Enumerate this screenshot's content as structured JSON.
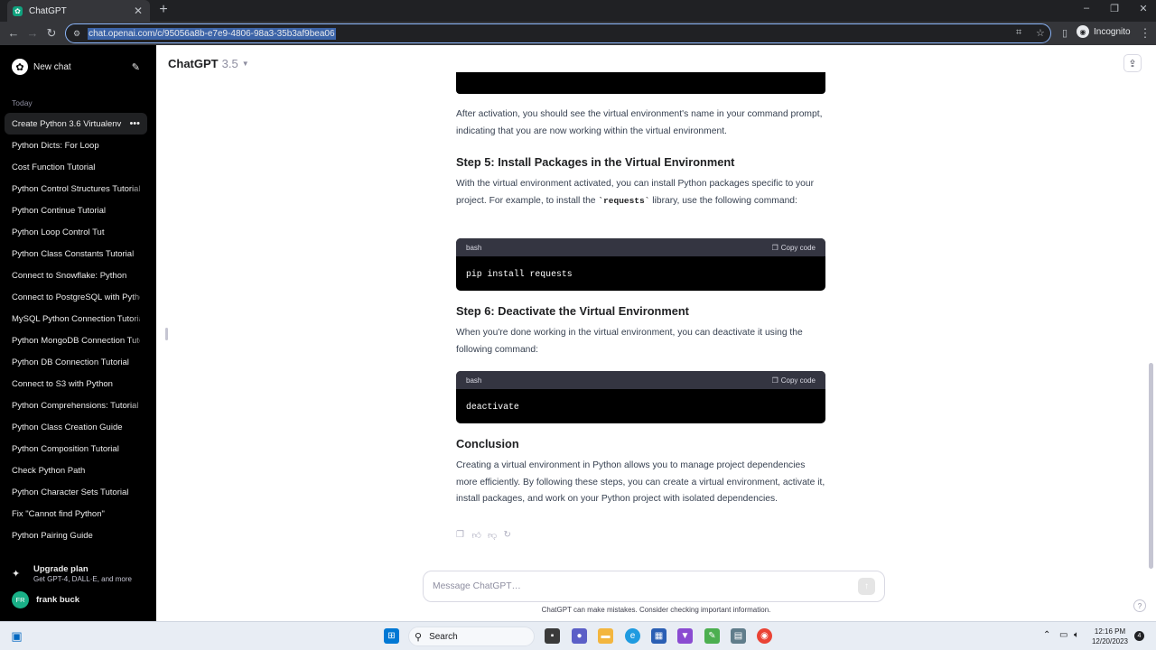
{
  "browser": {
    "tab_title": "ChatGPT",
    "tab_close": "✕",
    "new_tab": "+",
    "url": "chat.openai.com/c/95056a8b-e7e9-4806-98a3-35b3af9bea06",
    "profile_label": "Incognito"
  },
  "sidebar": {
    "new_chat_label": "New chat",
    "section_label": "Today",
    "chats": [
      {
        "title": "Create Python 3.6 Virtualenv"
      },
      {
        "title": "Python Dicts: For Loop"
      },
      {
        "title": "Cost Function Tutorial"
      },
      {
        "title": "Python Control Structures Tutorial"
      },
      {
        "title": "Python Continue Tutorial"
      },
      {
        "title": "Python Loop Control Tut"
      },
      {
        "title": "Python Class Constants Tutorial"
      },
      {
        "title": "Connect to Snowflake: Python"
      },
      {
        "title": "Connect to PostgreSQL with Python"
      },
      {
        "title": "MySQL Python Connection Tutorial"
      },
      {
        "title": "Python MongoDB Connection Tutorial"
      },
      {
        "title": "Python DB Connection Tutorial"
      },
      {
        "title": "Connect to S3 with Python"
      },
      {
        "title": "Python Comprehensions: Tutorial"
      },
      {
        "title": "Python Class Creation Guide"
      },
      {
        "title": "Python Composition Tutorial"
      },
      {
        "title": "Check Python Path"
      },
      {
        "title": "Python Character Sets Tutorial"
      },
      {
        "title": "Fix \"Cannot find Python\""
      },
      {
        "title": "Python Pairing Guide"
      }
    ],
    "upgrade_title": "Upgrade plan",
    "upgrade_sub": "Get GPT-4, DALL·E, and more",
    "user_initials": "FR",
    "user_name": "frank buck"
  },
  "header": {
    "model_name": "ChatGPT",
    "model_version": "3.5"
  },
  "message": {
    "p_after_activation": "After activation, you should see the virtual environment's name in your command prompt, indicating that you are now working within the virtual environment.",
    "h_step5": "Step 5: Install Packages in the Virtual Environment",
    "p_step5_pre": "With the virtual environment activated, you can install Python packages specific to your project. For example, to install the ",
    "p_step5_code": "`requests`",
    "p_step5_post": " library, use the following command:",
    "code1": {
      "lang": "bash",
      "copy_label": "Copy code",
      "code": "pip install requests"
    },
    "h_step6": "Step 6: Deactivate the Virtual Environment",
    "p_step6": "When you're done working in the virtual environment, you can deactivate it using the following command:",
    "code2": {
      "lang": "bash",
      "copy_label": "Copy code",
      "code": "deactivate"
    },
    "h_conclusion": "Conclusion",
    "p_conclusion": "Creating a virtual environment in Python allows you to manage project dependencies more efficiently. By following these steps, you can create a virtual environment, activate it, install packages, and work on your Python project with isolated dependencies."
  },
  "composer": {
    "placeholder": "Message ChatGPT…"
  },
  "disclaimer": "ChatGPT can make mistakes. Consider checking important information.",
  "help": "?",
  "taskbar": {
    "search_label": "Search",
    "time": "12:16 PM",
    "date": "12/20/2023",
    "notifications": "4"
  }
}
